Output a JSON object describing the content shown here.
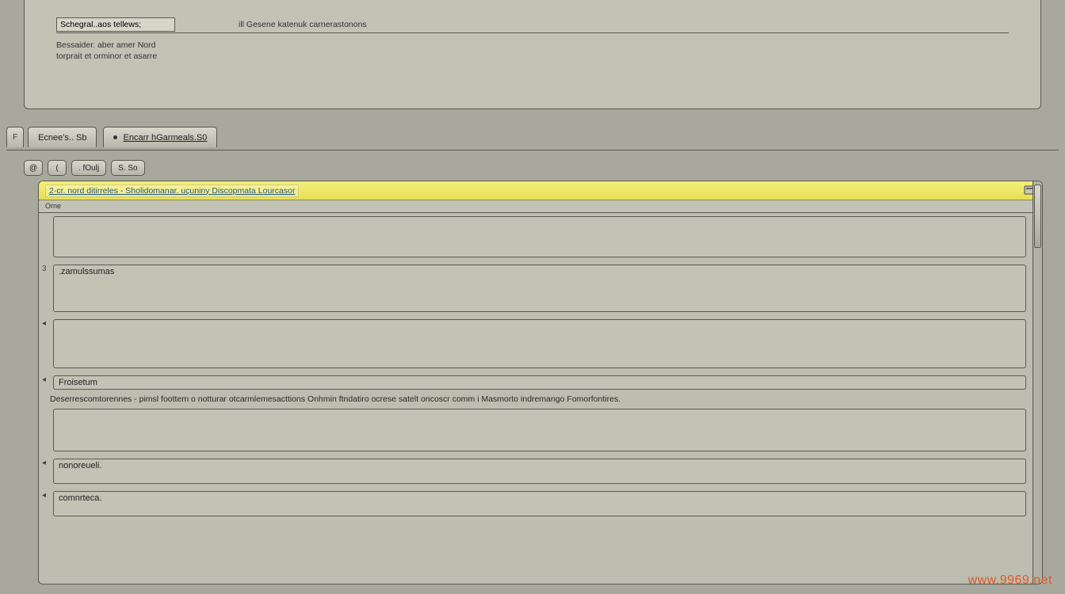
{
  "top": {
    "input_value": "Schegral..aos tellews;",
    "right_text": "ill Gesene katenuk carnerastonons",
    "line2a": "Bessaider. aber amer Nord",
    "line2b": "torprait et orminor et asarre"
  },
  "tabs": {
    "mini_label": "F",
    "tab1": "Ecnee's.. Sb",
    "tab2": "Encarr hGarmeals.S0"
  },
  "subbar": {
    "btn1": "@",
    "btn2": "(",
    "btn3": ". fOulj",
    "btn4": "S.    So"
  },
  "yellow": {
    "link": "2-cr. nord ditirreles - Sholidomanar. uçuniny Discopmata Lourcasor",
    "subline": "Orne"
  },
  "fields": {
    "f1": {
      "handle": "",
      "value": ""
    },
    "f2": {
      "handle": "3",
      "value": ".zamulssumas"
    },
    "f3": {
      "handle": "",
      "value": ""
    },
    "f4": {
      "handle": "",
      "value": "Froisetum"
    },
    "f4_below": "Deserrescomtorennes - pimsl foottem o notturar otcarmlemesacttions Onhmin ftndatiro ocrese satelt oncoscr comm i Masmorto indremango Fomorfontires.",
    "f5": {
      "value": ""
    },
    "f6": {
      "value": "nonoreueli."
    },
    "f7": {
      "value": "comnrteca."
    }
  },
  "watermark": "www.9969.net"
}
